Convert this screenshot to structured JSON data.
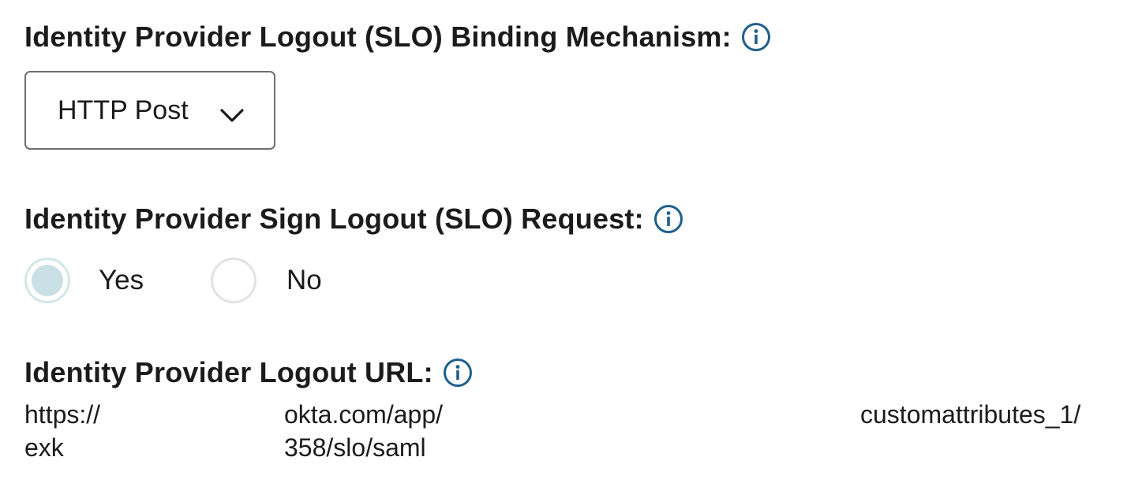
{
  "binding": {
    "label": "Identity Provider Logout (SLO) Binding Mechanism:",
    "info_icon": "info-circle-icon",
    "selected_value": "HTTP Post",
    "chevron_icon": "chevron-down-icon"
  },
  "sign_request": {
    "label": "Identity Provider Sign Logout (SLO) Request:",
    "info_icon": "info-circle-icon",
    "options": [
      {
        "label": "Yes",
        "selected": true
      },
      {
        "label": "No",
        "selected": false
      }
    ]
  },
  "logout_url": {
    "label": "Identity Provider Logout URL:",
    "info_icon": "info-circle-icon",
    "segments": {
      "line1_start": "https://",
      "line1_mid": "okta.com/app/",
      "line1_end": "customattributes_1/",
      "line2_start": "exk",
      "line2_mid": "358/slo/saml"
    }
  },
  "colors": {
    "text": "#1b1b1b",
    "info_icon": "#1f5f8b",
    "select_border": "#6e6e6e",
    "radio_selected_fill": "#c9e0e6",
    "radio_selected_ring": "#d3e6ea",
    "radio_unselected_ring": "#e2e2e2"
  }
}
